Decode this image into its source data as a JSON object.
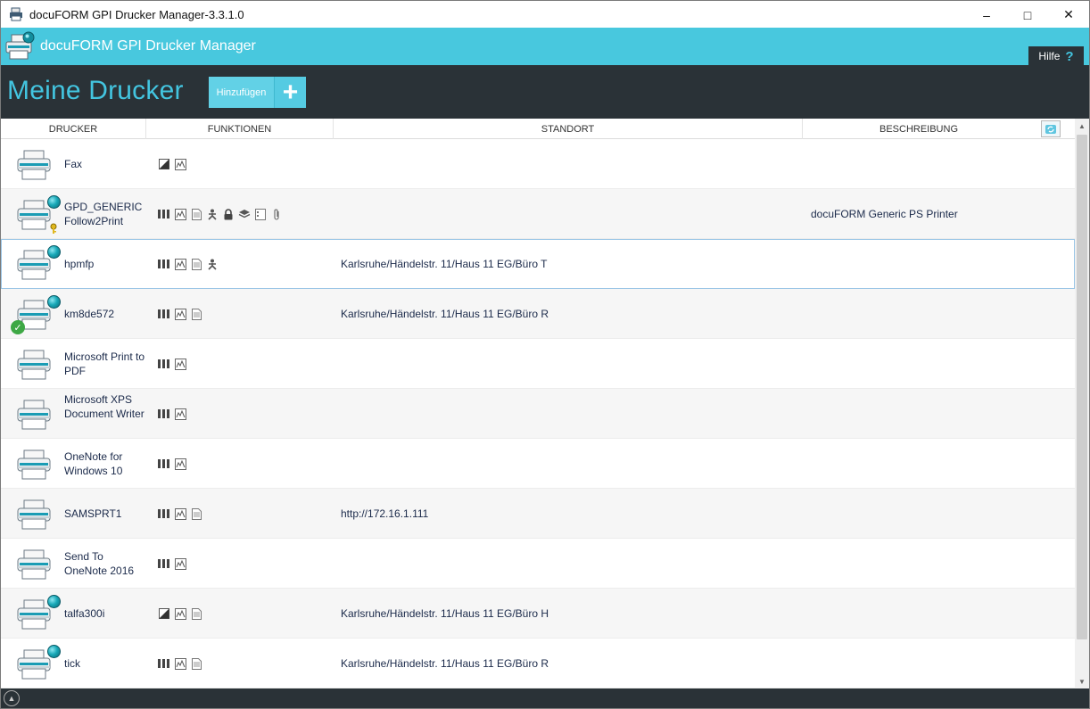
{
  "window": {
    "title": "docuFORM GPI Drucker Manager-3.3.1.0"
  },
  "header": {
    "app_title": "docuFORM GPI Drucker Manager",
    "help_label": "Hilfe",
    "help_icon": "?"
  },
  "toolbar": {
    "page_title": "Meine Drucker",
    "add_label": "Hinzufügen",
    "add_icon": "+"
  },
  "columns": [
    "DRUCKER",
    "FUNKTIONEN",
    "STANDORT",
    "BESCHREIBUNG"
  ],
  "colors": {
    "accent": "#48c8de",
    "dark": "#2a3237",
    "title_text": "#43c5e0",
    "ok": "#3ea845"
  },
  "printers": [
    {
      "name": "Fax",
      "functions": [
        "bw-icon",
        "preview-icon"
      ],
      "location": "",
      "description": "",
      "network": false,
      "status": ""
    },
    {
      "name": "GPD_GENERIC Follow2Print",
      "functions": [
        "color-bars-icon",
        "preview-icon",
        "document-icon",
        "person-icon",
        "lock-icon",
        "layers-icon",
        "card-icon",
        "paperclip-icon"
      ],
      "location": "",
      "description": "docuFORM Generic PS Printer",
      "network": true,
      "status": "key"
    },
    {
      "name": "hpmfp",
      "functions": [
        "color-bars-icon",
        "preview-icon",
        "document-icon",
        "person-icon"
      ],
      "location": "Karlsruhe/Händelstr. 11/Haus 11 EG/Büro T",
      "description": "",
      "network": true,
      "status": "",
      "selected": true
    },
    {
      "name": "km8de572",
      "functions": [
        "color-bars-icon",
        "preview-icon",
        "document-icon"
      ],
      "location": "Karlsruhe/Händelstr. 11/Haus 11 EG/Büro R",
      "description": "",
      "network": true,
      "status": "default"
    },
    {
      "name": "Microsoft Print to PDF",
      "functions": [
        "color-bars-icon",
        "preview-icon"
      ],
      "location": "",
      "description": "",
      "network": false,
      "status": ""
    },
    {
      "name": "Microsoft XPS Document Writer",
      "functions": [
        "color-bars-icon",
        "preview-icon"
      ],
      "location": "",
      "description": "",
      "network": false,
      "status": ""
    },
    {
      "name": "OneNote for Windows 10",
      "functions": [
        "color-bars-icon",
        "preview-icon"
      ],
      "location": "",
      "description": "",
      "network": false,
      "status": ""
    },
    {
      "name": "SAMSPRT1",
      "functions": [
        "color-bars-icon",
        "preview-icon",
        "document-icon"
      ],
      "location": "http://172.16.1.111",
      "description": "",
      "network": false,
      "status": ""
    },
    {
      "name": "Send To OneNote 2016",
      "functions": [
        "color-bars-icon",
        "preview-icon"
      ],
      "location": "",
      "description": "",
      "network": false,
      "status": ""
    },
    {
      "name": "talfa300i",
      "functions": [
        "bw-icon",
        "preview-icon",
        "document-icon"
      ],
      "location": "Karlsruhe/Händelstr. 11/Haus 11 EG/Büro H",
      "description": "",
      "network": true,
      "status": ""
    },
    {
      "name": "tick",
      "functions": [
        "color-bars-icon",
        "preview-icon",
        "document-icon"
      ],
      "location": "Karlsruhe/Händelstr. 11/Haus 11 EG/Büro R",
      "description": "",
      "network": true,
      "status": ""
    }
  ]
}
